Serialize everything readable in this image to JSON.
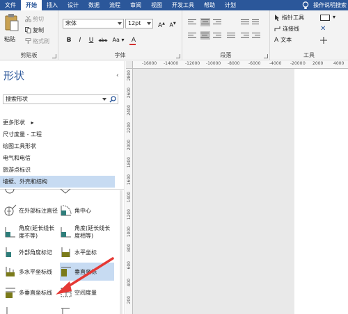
{
  "menubar": {
    "tabs": [
      "文件",
      "开始",
      "插入",
      "设计",
      "数据",
      "流程",
      "审阅",
      "视图",
      "开发工具",
      "帮助",
      "计划"
    ],
    "active_tab": "开始",
    "tell_me": "操作说明搜索"
  },
  "ribbon": {
    "clipboard": {
      "paste": "粘贴",
      "cut": "剪切",
      "copy": "复制",
      "format_painter": "格式刷",
      "label": "剪贴板"
    },
    "font": {
      "font_name": "宋体",
      "font_size": "12pt",
      "grow": "A",
      "shrink": "A",
      "bold": "B",
      "italic": "I",
      "underline": "U",
      "strike": "abc",
      "case": "Aa",
      "font_color": "A",
      "label": "字体"
    },
    "paragraph": {
      "label": "段落"
    },
    "tools": {
      "pointer": "指针工具",
      "connector": "连接线",
      "text": "文本",
      "label": "工具"
    }
  },
  "shapes_panel": {
    "title": "形状",
    "collapse": "‹",
    "search_placeholder": "搜索形状",
    "stencils": [
      {
        "label": "更多形状",
        "chev": "▸"
      },
      {
        "label": "尺寸度量 - 工程"
      },
      {
        "label": "绘图工具形状"
      },
      {
        "label": "电气和电信"
      },
      {
        "label": "旅游点标识"
      },
      {
        "label": "墙壁、外壳和结构"
      }
    ],
    "selected_stencil": "墙壁、外壳和结构",
    "shape_items": [
      {
        "label": "在外部标注直径"
      },
      {
        "label": "角中心"
      },
      {
        "label": "角度(延长线长度不等)"
      },
      {
        "label": "角度(延长线长度相等)"
      },
      {
        "label": "外部角度标记"
      },
      {
        "label": "水平坐标"
      },
      {
        "label": "多水平坐标线"
      },
      {
        "label": "垂直坐标"
      },
      {
        "label": "多垂直坐标线"
      },
      {
        "label": "空间度量"
      }
    ]
  },
  "canvas": {
    "hruler_labels": [
      "-16000",
      "-14000",
      "-12000",
      "-10000",
      "-8000",
      "-6000",
      "-4000",
      "-2000",
      "0",
      "2000",
      "4000"
    ],
    "vruler_labels": [
      "2800",
      "2600",
      "2400",
      "2200",
      "2000",
      "1800",
      "1600",
      "1400",
      "1200",
      "1000",
      "800",
      "600",
      "400",
      "200"
    ]
  },
  "colors": {
    "accent": "#2b579a",
    "selection": "#c7dbf2",
    "annotation_arrow": "#e53935",
    "shape_olive": "#7a7a1a",
    "shape_teal": "#2e7d7a"
  }
}
